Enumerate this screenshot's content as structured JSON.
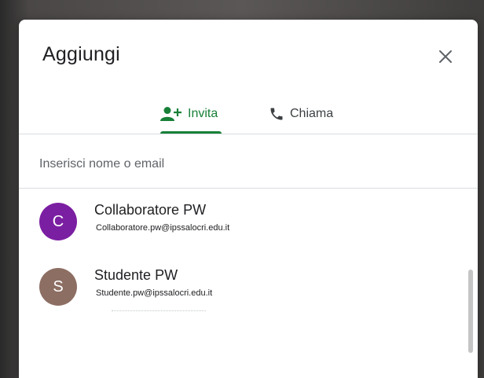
{
  "dialog": {
    "title": "Aggiungi",
    "close_icon": "close-icon"
  },
  "tabs": [
    {
      "label": "Invita",
      "icon": "person-add-icon",
      "active": true,
      "color": "#188038"
    },
    {
      "label": "Chiama",
      "icon": "phone-icon",
      "active": false,
      "color": "#3c4043"
    }
  ],
  "search": {
    "placeholder": "Inserisci nome o email",
    "value": ""
  },
  "contacts": [
    {
      "initial": "C",
      "name": "Collaboratore PW",
      "email": "Collaboratore.pw@ipssalocri.edu.it",
      "avatar_color": "#7b1fa2"
    },
    {
      "initial": "S",
      "name": "Studente PW",
      "email": "Studente.pw@ipssalocri.edu.it",
      "avatar_color": "#8d6e63"
    }
  ]
}
